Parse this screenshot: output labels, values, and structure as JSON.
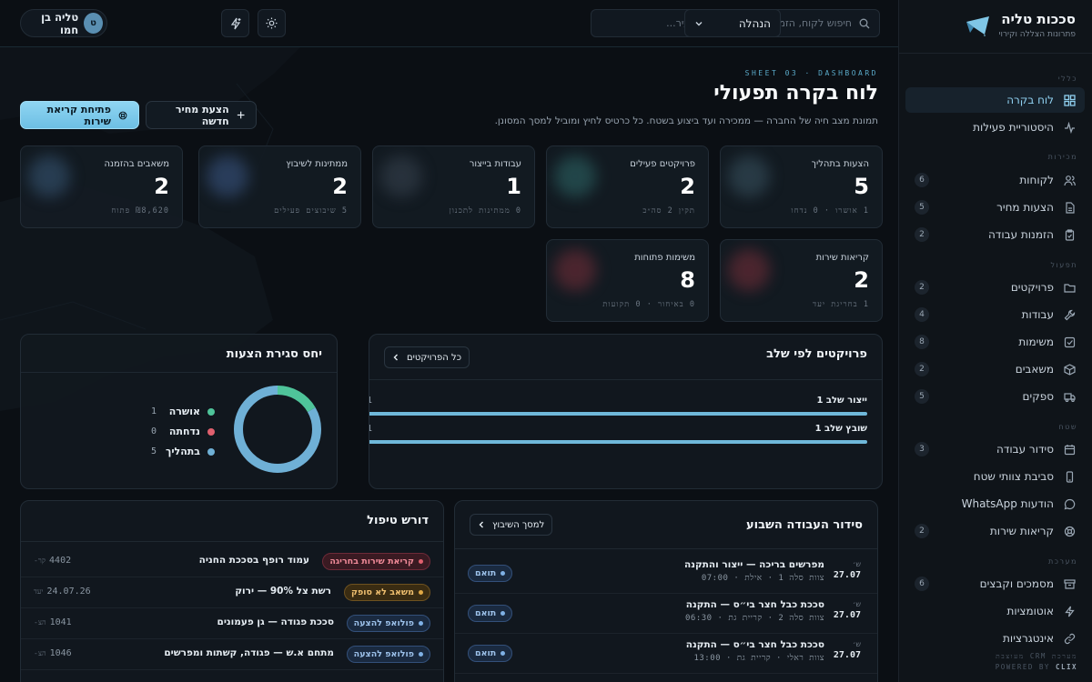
{
  "sidebar": {
    "brand_title": "סככות טליה",
    "brand_subtitle": "פתרונות הצללה וקירוי",
    "sections": {
      "general": "כללי",
      "sales": "מכירות",
      "production": "תפעול",
      "operations": "שטח",
      "system": "מערכת"
    },
    "items": [
      {
        "label": "לוח בקרה",
        "icon": "grid-icon",
        "count": ""
      },
      {
        "label": "היסטוריית פעילות",
        "icon": "activity-icon",
        "count": ""
      },
      {
        "label": "לקוחות",
        "icon": "users-icon",
        "count": "6"
      },
      {
        "label": "הצעות מחיר",
        "icon": "document-icon",
        "count": "5"
      },
      {
        "label": "הזמנות עבודה",
        "icon": "clipboard-icon",
        "count": "2"
      },
      {
        "label": "פרויקטים",
        "icon": "folder-icon",
        "count": "2"
      },
      {
        "label": "עבודות",
        "icon": "wrench-icon",
        "count": "4"
      },
      {
        "label": "משימות",
        "icon": "checkbox-icon",
        "count": "8"
      },
      {
        "label": "משאבים",
        "icon": "box-icon",
        "count": "2"
      },
      {
        "label": "ספקים",
        "icon": "truck-icon",
        "count": "5"
      },
      {
        "label": "סידור עבודה",
        "icon": "calendar-icon",
        "count": "3"
      },
      {
        "label": "סביבת צוותי שטח",
        "icon": "phone-icon",
        "count": ""
      },
      {
        "label": "הודעות WhatsApp",
        "icon": "chat-icon",
        "count": ""
      },
      {
        "label": "קריאות שירות",
        "icon": "lifebuoy-icon",
        "count": "2"
      },
      {
        "label": "מסמכים וקבצים",
        "icon": "archive-icon",
        "count": "6"
      },
      {
        "label": "אוטומציות",
        "icon": "bolt-icon",
        "count": ""
      },
      {
        "label": "אינטגרציות",
        "icon": "link-icon",
        "count": ""
      }
    ],
    "footer_line1": "מערכת CRM מעוצבת",
    "footer_line2_prefix": "POWERED BY",
    "footer_line2_brand": "CLIX"
  },
  "topbar": {
    "search_placeholder": "חיפוש לקוח, הזמנה, פרויקט, שרטוט, עיר...",
    "role": "הנהלה",
    "user_name": "טליה בן חמו",
    "user_initial": "ט"
  },
  "page": {
    "eyebrow": "SHEET 03 · DASHBOARD",
    "title": "לוח בקרה תפעולי",
    "subtitle": "תמונת מצב חיה של החברה — ממכירה ועד ביצוע בשטח. כל כרטיס לחיץ ומוביל למסך המסונן.",
    "new_quote_label": "הצעת מחיר חדשה",
    "open_service_label": "פתיחת קריאת שירות"
  },
  "stats": [
    {
      "label": "הצעות בתהליך",
      "value": "5",
      "meta": "1 אושרו · 0 נדחו",
      "glow": "#3b5563"
    },
    {
      "label": "פרויקטים פעילים",
      "value": "2",
      "meta": "תקין 2 סה״כ",
      "glow": "#2f6a6a"
    },
    {
      "label": "עבודות בייצור",
      "value": "1",
      "meta": "0 ממתינות לתכנון",
      "glow": "#3a4552"
    },
    {
      "label": "ממתינות לשיבוץ",
      "value": "2",
      "meta": "5 שיבוצים פעילים",
      "glow": "#3d5a8a"
    },
    {
      "label": "משאבים בהזמנה",
      "value": "2",
      "meta": "₪8,620 פתוח",
      "glow": "#3a5a7a"
    },
    {
      "label": "קריאות שירות",
      "value": "2",
      "meta": "1 בחריגת יעד",
      "glow": "#7a2f3a"
    },
    {
      "label": "משימות פתוחות",
      "value": "8",
      "meta": "0 באיחור · 0 תקועות",
      "glow": "#7a2f3a"
    }
  ],
  "projects_panel": {
    "title": "פרויקטים לפי שלב",
    "all_label": "כל הפרויקטים",
    "stages": [
      {
        "name": "ייצור שלב 1",
        "count": "1",
        "fraction": 1.0
      },
      {
        "name": "שובץ שלב 1",
        "count": "1",
        "fraction": 1.0
      }
    ]
  },
  "quotes_panel": {
    "title": "יחס סגירת הצעות",
    "legend": [
      {
        "label": "אושרה",
        "value": 1,
        "color": "#4fc49a"
      },
      {
        "label": "נדחתה",
        "value": 0,
        "color": "#e0606e"
      },
      {
        "label": "בתהליך",
        "value": 5,
        "color": "#6fb0d6"
      }
    ]
  },
  "schedule_panel": {
    "title": "סידור העבודה השבוע",
    "link_label": "למסך השיבוץ",
    "rows": [
      {
        "day": "ש׳",
        "date": "27.07",
        "title": "מפרשים בריכה — ייצור והתקנה",
        "meta": "צוות סלה 1 · אילת · 07:00",
        "status": "תואם"
      },
      {
        "day": "ש׳",
        "date": "27.07",
        "title": "סככת כבל חצר בי״ס — התקנה",
        "meta": "צוות סלה 2 · קריית גת · 06:30",
        "status": "תואם"
      },
      {
        "day": "ש׳",
        "date": "27.07",
        "title": "סככת כבל חצר בי״ס — התקנה",
        "meta": "צוות ראלי · קריית גת · 13:00",
        "status": "תואם"
      }
    ]
  },
  "attention_panel": {
    "title": "דורש טיפול",
    "rows": [
      {
        "tag": "קריאת שירות בחריגה",
        "tone": "red",
        "text": "עמוד רופף בסככת החניה",
        "ref_label": "קר-",
        "ref": "4402"
      },
      {
        "tag": "משאב לא סופק",
        "tone": "amber",
        "text": "רשת צל 90% — ירוק",
        "ref_label": "יעד",
        "ref": "24.07.26"
      },
      {
        "tag": "פולואפ להצעה",
        "tone": "blue",
        "text": "סככת פגודה — גן פעמונים",
        "ref_label": "הצ-",
        "ref": "1041"
      },
      {
        "tag": "פולואפ להצעה",
        "tone": "blue",
        "text": "מתחם א.ש — פגודה, קשתות ומפרשים",
        "ref_label": "הצ-",
        "ref": "1046"
      }
    ]
  }
}
